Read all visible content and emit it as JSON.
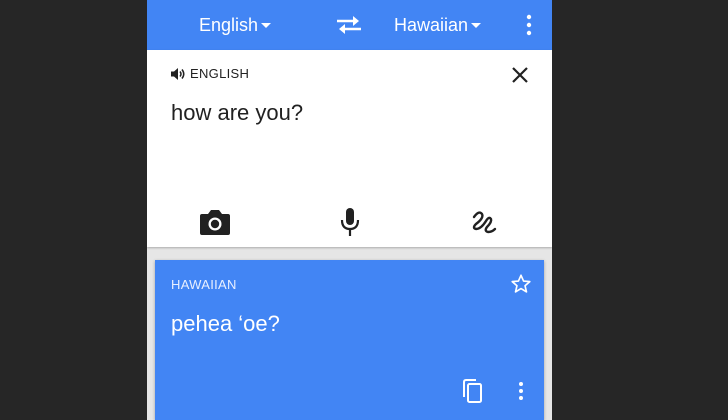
{
  "header": {
    "source_language": "English",
    "target_language": "Hawaiian"
  },
  "source": {
    "language_label": "ENGLISH",
    "text": "how are you?"
  },
  "result": {
    "language_label": "HAWAIIAN",
    "text": "pehea ‘oe?"
  },
  "icons": {
    "swap": "swap-arrows-icon",
    "menu": "more-vertical-icon",
    "speaker": "speaker-icon",
    "close": "close-icon",
    "camera": "camera-icon",
    "mic": "microphone-icon",
    "handwriting": "handwriting-icon",
    "star": "star-outline-icon",
    "copy": "copy-icon"
  },
  "colors": {
    "accent": "#4285f4",
    "background": "#262626",
    "card": "#ffffff"
  }
}
